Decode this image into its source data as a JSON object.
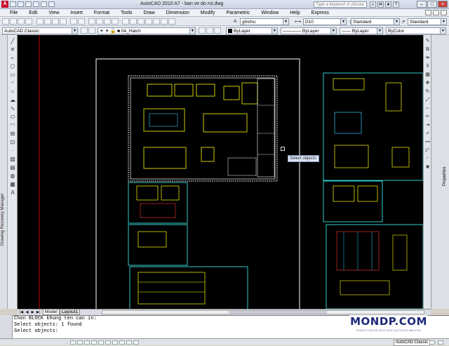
{
  "titlebar": {
    "app_logo": "A",
    "title": "AutoCAD 2010     A7 - ban ve do roi.dwg",
    "search_placeholder": "Type a keyword or phrase",
    "icons": [
      "search-icon",
      "communication-icon",
      "star-icon",
      "help-icon"
    ],
    "window_buttons": {
      "minimize": "–",
      "maximize": "□",
      "close": "×"
    }
  },
  "menu": [
    "File",
    "Edit",
    "View",
    "Insert",
    "Format",
    "Tools",
    "Draw",
    "Dimension",
    "Modify",
    "Parametric",
    "Window",
    "Help",
    "Express"
  ],
  "toolbar": {
    "workspace": "AutoCAD Classic",
    "layer": "04_Hatch",
    "text_style": "ghichu",
    "dim_style": "D10",
    "table_style": "Standard",
    "multileader_style": "Standard",
    "color": "ByLayer",
    "linetype": "ByLayer",
    "lineweight": "ByLayer",
    "plot_style": "ByColor"
  },
  "palettes": {
    "recovery": "Drawing Recovery Manager",
    "properties": "Properties"
  },
  "canvas": {
    "tooltip": "Select objects:",
    "colors": {
      "background": "#000000",
      "frame": "#ffffff",
      "border": "#33cccc",
      "geometry": "#ffff00",
      "accent": "#ff3333",
      "detail": "#33ccff"
    }
  },
  "tabs": {
    "model": "Model",
    "layout": "Layout1"
  },
  "command_line": [
    "Chon BLOCK khung ten can in:",
    "Select objects: 1 found",
    "Select objects:"
  ],
  "status": {
    "workspace": "AutoCAD Classic"
  },
  "watermark": {
    "title": "MONDP.COM",
    "subtitle": "TRANG CHIA SE KIEN THUC AUTOCAD MIEN PHI"
  }
}
